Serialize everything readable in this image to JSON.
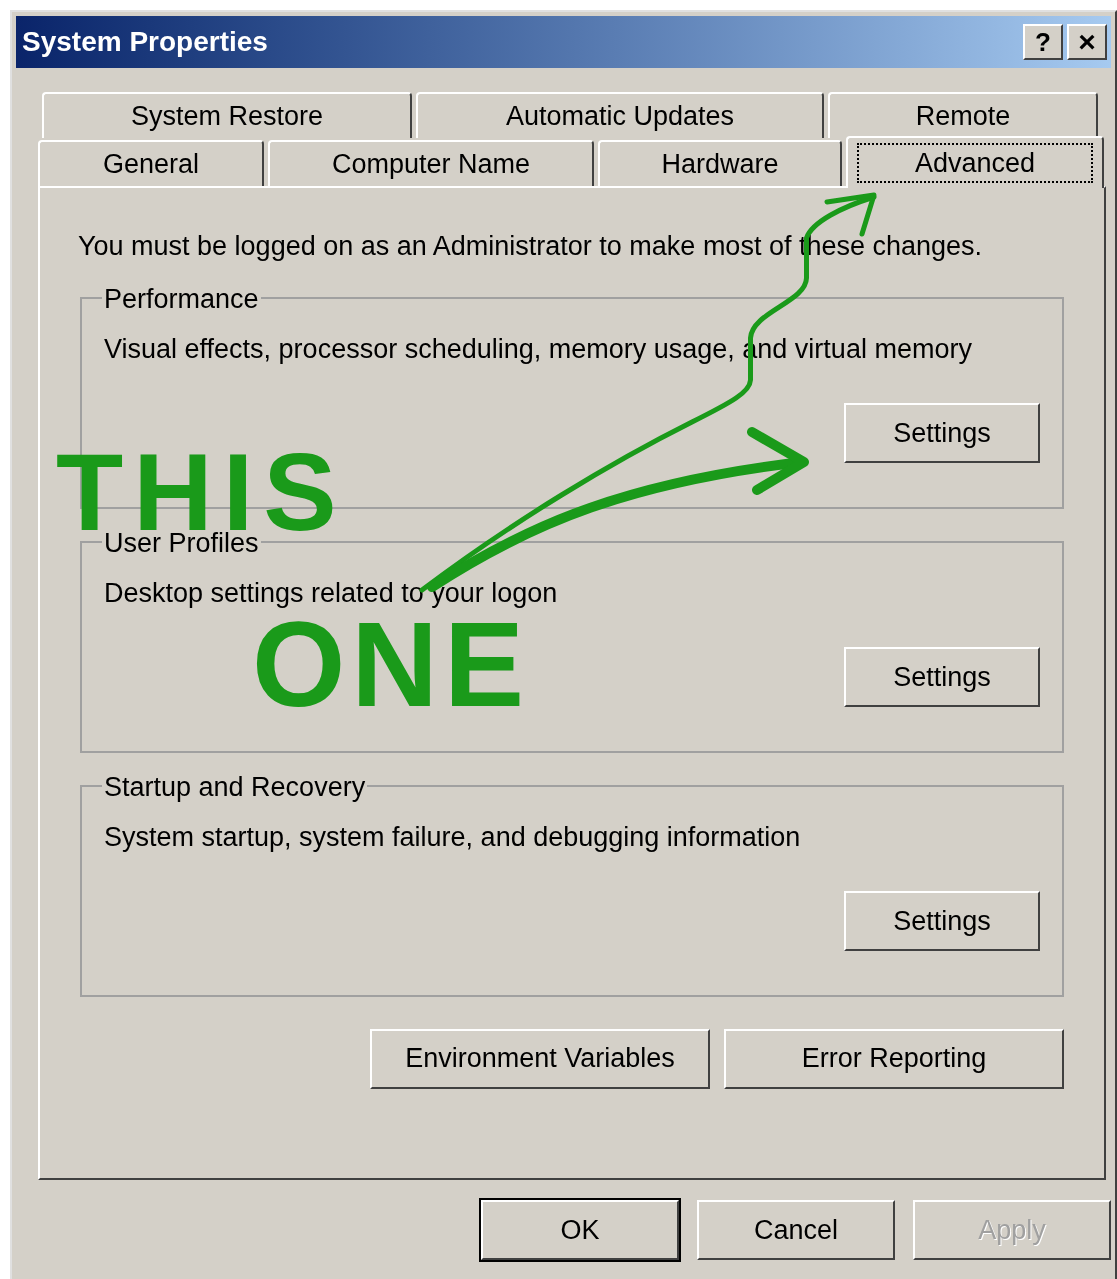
{
  "window": {
    "title": "System Properties",
    "help_button": "?",
    "close_button": "×"
  },
  "tab_rows": [
    [
      {
        "label": "System Restore",
        "selected": false
      },
      {
        "label": "Automatic Updates",
        "selected": false
      },
      {
        "label": "Remote",
        "selected": false
      }
    ],
    [
      {
        "label": "General",
        "selected": false
      },
      {
        "label": "Computer Name",
        "selected": false
      },
      {
        "label": "Hardware",
        "selected": false
      },
      {
        "label": "Advanced",
        "selected": true
      }
    ]
  ],
  "notice": "You must be logged on as an Administrator to make most of these changes.",
  "groups": [
    {
      "title": "Performance",
      "description": "Visual effects, processor scheduling, memory usage, and virtual memory",
      "button": "Settings"
    },
    {
      "title": "User Profiles",
      "description": "Desktop settings related to your logon",
      "button": "Settings"
    },
    {
      "title": "Startup and Recovery",
      "description": "System startup, system failure, and debugging information",
      "button": "Settings"
    }
  ],
  "extra_buttons": [
    "Environment Variables",
    "Error Reporting"
  ],
  "dialog_buttons": [
    {
      "label": "OK",
      "default": true,
      "disabled": false
    },
    {
      "label": "Cancel",
      "default": false,
      "disabled": false
    },
    {
      "label": "Apply",
      "default": false,
      "disabled": true
    }
  ],
  "annotation": {
    "words": [
      "THIS",
      "ONE"
    ]
  }
}
